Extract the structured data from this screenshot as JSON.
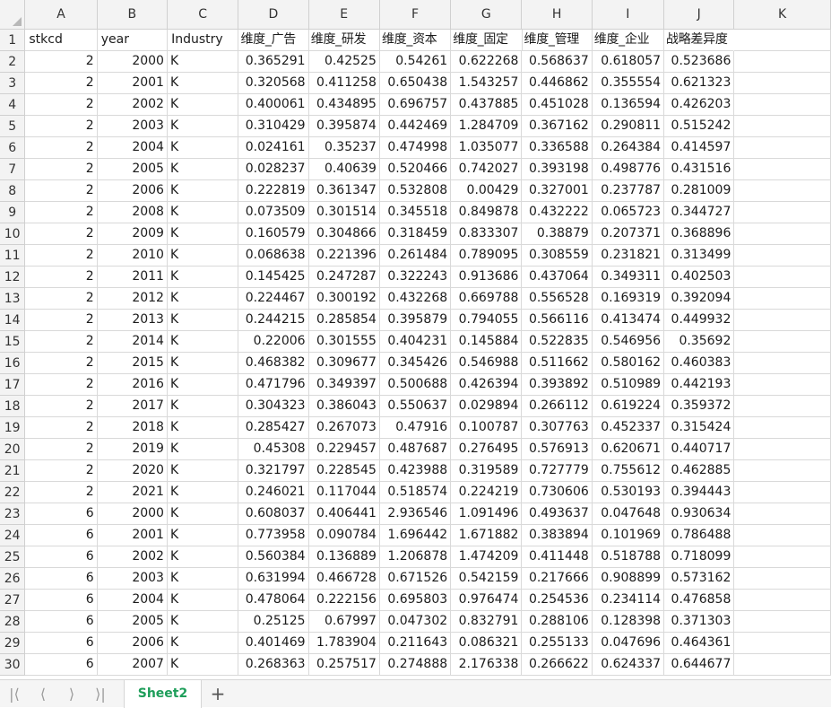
{
  "columns": [
    "A",
    "B",
    "C",
    "D",
    "E",
    "F",
    "G",
    "H",
    "I",
    "J",
    "K"
  ],
  "header_row": {
    "number": "1",
    "cells": [
      "stkcd",
      "year",
      "Industry",
      "维度_广告",
      "维度_研发",
      "维度_资本",
      "维度_固定",
      "维度_管理",
      "维度_企业",
      "战略差异度",
      ""
    ]
  },
  "rows": [
    {
      "n": "2",
      "v": [
        "2",
        "2000",
        "K",
        "0.365291",
        "0.42525",
        "0.54261",
        "0.622268",
        "0.568637",
        "0.618057",
        "0.523686"
      ]
    },
    {
      "n": "3",
      "v": [
        "2",
        "2001",
        "K",
        "0.320568",
        "0.411258",
        "0.650438",
        "1.543257",
        "0.446862",
        "0.355554",
        "0.621323"
      ]
    },
    {
      "n": "4",
      "v": [
        "2",
        "2002",
        "K",
        "0.400061",
        "0.434895",
        "0.696757",
        "0.437885",
        "0.451028",
        "0.136594",
        "0.426203"
      ]
    },
    {
      "n": "5",
      "v": [
        "2",
        "2003",
        "K",
        "0.310429",
        "0.395874",
        "0.442469",
        "1.284709",
        "0.367162",
        "0.290811",
        "0.515242"
      ]
    },
    {
      "n": "6",
      "v": [
        "2",
        "2004",
        "K",
        "0.024161",
        "0.35237",
        "0.474998",
        "1.035077",
        "0.336588",
        "0.264384",
        "0.414597"
      ]
    },
    {
      "n": "7",
      "v": [
        "2",
        "2005",
        "K",
        "0.028237",
        "0.40639",
        "0.520466",
        "0.742027",
        "0.393198",
        "0.498776",
        "0.431516"
      ]
    },
    {
      "n": "8",
      "v": [
        "2",
        "2006",
        "K",
        "0.222819",
        "0.361347",
        "0.532808",
        "0.00429",
        "0.327001",
        "0.237787",
        "0.281009"
      ]
    },
    {
      "n": "9",
      "v": [
        "2",
        "2008",
        "K",
        "0.073509",
        "0.301514",
        "0.345518",
        "0.849878",
        "0.432222",
        "0.065723",
        "0.344727"
      ]
    },
    {
      "n": "10",
      "v": [
        "2",
        "2009",
        "K",
        "0.160579",
        "0.304866",
        "0.318459",
        "0.833307",
        "0.38879",
        "0.207371",
        "0.368896"
      ]
    },
    {
      "n": "11",
      "v": [
        "2",
        "2010",
        "K",
        "0.068638",
        "0.221396",
        "0.261484",
        "0.789095",
        "0.308559",
        "0.231821",
        "0.313499"
      ]
    },
    {
      "n": "12",
      "v": [
        "2",
        "2011",
        "K",
        "0.145425",
        "0.247287",
        "0.322243",
        "0.913686",
        "0.437064",
        "0.349311",
        "0.402503"
      ]
    },
    {
      "n": "13",
      "v": [
        "2",
        "2012",
        "K",
        "0.224467",
        "0.300192",
        "0.432268",
        "0.669788",
        "0.556528",
        "0.169319",
        "0.392094"
      ]
    },
    {
      "n": "14",
      "v": [
        "2",
        "2013",
        "K",
        "0.244215",
        "0.285854",
        "0.395879",
        "0.794055",
        "0.566116",
        "0.413474",
        "0.449932"
      ]
    },
    {
      "n": "15",
      "v": [
        "2",
        "2014",
        "K",
        "0.22006",
        "0.301555",
        "0.404231",
        "0.145884",
        "0.522835",
        "0.546956",
        "0.35692"
      ]
    },
    {
      "n": "16",
      "v": [
        "2",
        "2015",
        "K",
        "0.468382",
        "0.309677",
        "0.345426",
        "0.546988",
        "0.511662",
        "0.580162",
        "0.460383"
      ]
    },
    {
      "n": "17",
      "v": [
        "2",
        "2016",
        "K",
        "0.471796",
        "0.349397",
        "0.500688",
        "0.426394",
        "0.393892",
        "0.510989",
        "0.442193"
      ]
    },
    {
      "n": "18",
      "v": [
        "2",
        "2017",
        "K",
        "0.304323",
        "0.386043",
        "0.550637",
        "0.029894",
        "0.266112",
        "0.619224",
        "0.359372"
      ]
    },
    {
      "n": "19",
      "v": [
        "2",
        "2018",
        "K",
        "0.285427",
        "0.267073",
        "0.47916",
        "0.100787",
        "0.307763",
        "0.452337",
        "0.315424"
      ]
    },
    {
      "n": "20",
      "v": [
        "2",
        "2019",
        "K",
        "0.45308",
        "0.229457",
        "0.487687",
        "0.276495",
        "0.576913",
        "0.620671",
        "0.440717"
      ]
    },
    {
      "n": "21",
      "v": [
        "2",
        "2020",
        "K",
        "0.321797",
        "0.228545",
        "0.423988",
        "0.319589",
        "0.727779",
        "0.755612",
        "0.462885"
      ]
    },
    {
      "n": "22",
      "v": [
        "2",
        "2021",
        "K",
        "0.246021",
        "0.117044",
        "0.518574",
        "0.224219",
        "0.730606",
        "0.530193",
        "0.394443"
      ]
    },
    {
      "n": "23",
      "v": [
        "6",
        "2000",
        "K",
        "0.608037",
        "0.406441",
        "2.936546",
        "1.091496",
        "0.493637",
        "0.047648",
        "0.930634"
      ]
    },
    {
      "n": "24",
      "v": [
        "6",
        "2001",
        "K",
        "0.773958",
        "0.090784",
        "1.696442",
        "1.671882",
        "0.383894",
        "0.101969",
        "0.786488"
      ]
    },
    {
      "n": "25",
      "v": [
        "6",
        "2002",
        "K",
        "0.560384",
        "0.136889",
        "1.206878",
        "1.474209",
        "0.411448",
        "0.518788",
        "0.718099"
      ]
    },
    {
      "n": "26",
      "v": [
        "6",
        "2003",
        "K",
        "0.631994",
        "0.466728",
        "0.671526",
        "0.542159",
        "0.217666",
        "0.908899",
        "0.573162"
      ]
    },
    {
      "n": "27",
      "v": [
        "6",
        "2004",
        "K",
        "0.478064",
        "0.222156",
        "0.695803",
        "0.976474",
        "0.254536",
        "0.234114",
        "0.476858"
      ]
    },
    {
      "n": "28",
      "v": [
        "6",
        "2005",
        "K",
        "0.25125",
        "0.67997",
        "0.047302",
        "0.832791",
        "0.288106",
        "0.128398",
        "0.371303"
      ]
    },
    {
      "n": "29",
      "v": [
        "6",
        "2006",
        "K",
        "0.401469",
        "1.783904",
        "0.211643",
        "0.086321",
        "0.255133",
        "0.047696",
        "0.464361"
      ]
    },
    {
      "n": "30",
      "v": [
        "6",
        "2007",
        "K",
        "0.268363",
        "0.257517",
        "0.274888",
        "2.176338",
        "0.266622",
        "0.624337",
        "0.644677"
      ]
    }
  ],
  "sheet_bar": {
    "nav_icons": [
      "first-sheet-icon",
      "prev-sheet-icon",
      "next-sheet-icon",
      "last-sheet-icon"
    ],
    "active_sheet": "Sheet2",
    "active_sheet_color": "#1e9e5a",
    "add_sheet_icon": "plus-icon"
  }
}
